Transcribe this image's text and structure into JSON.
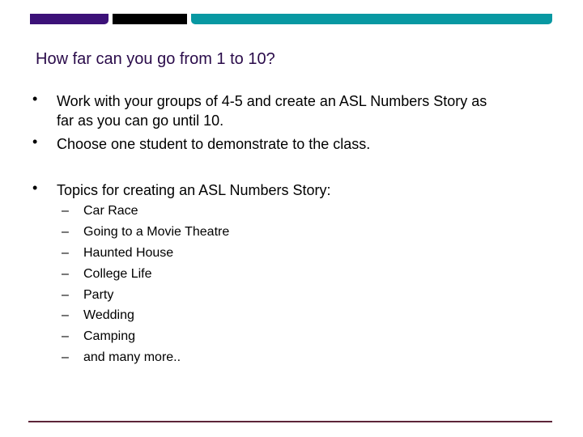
{
  "colors": {
    "bar_purple": "#3c1178",
    "bar_black": "#000000",
    "bar_teal": "#0898a2",
    "title": "#2a0b4a",
    "bottom_line": "#5c2438"
  },
  "slide": {
    "title": "How far can you go from 1 to 10?",
    "bullet_glyph": "•",
    "dash_glyph": "–",
    "bullets": [
      {
        "line1": "Work with your groups of 4-5 and create an ASL Numbers Story as",
        "line2": "far as you can go until 10."
      },
      {
        "line1": "Choose one student to demonstrate to the class."
      },
      {
        "line1": "Topics for creating an ASL Numbers Story:"
      }
    ],
    "topics": [
      "Car Race",
      "Going to a Movie Theatre",
      "Haunted House",
      "College Life",
      "Party",
      "Wedding",
      "Camping",
      "and many more.."
    ]
  }
}
